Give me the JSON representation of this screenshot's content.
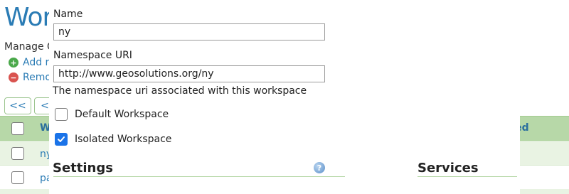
{
  "background": {
    "title": "Work",
    "manage_text": "Manage G",
    "add_label": "Add r",
    "remove_label": "Remo",
    "pager": {
      "first_label": "<<",
      "prev_label": "<"
    },
    "table": {
      "header_label": "W",
      "header_label_right": "ated",
      "rows": [
        {
          "name": "ny"
        },
        {
          "name": "pa"
        }
      ]
    }
  },
  "dialog": {
    "name_label": "Name",
    "name_value": "ny",
    "namespace_label": "Namespace URI",
    "namespace_value": "http://www.geosolutions.org/ny",
    "namespace_help": "The namespace uri associated with this workspace",
    "default_workspace_label": "Default Workspace",
    "default_workspace_checked": false,
    "isolated_workspace_label": "Isolated Workspace",
    "isolated_workspace_checked": true,
    "settings_title": "Settings",
    "services_title": "Services",
    "help_icon": "help-icon"
  },
  "colors": {
    "link": "#2b7cb5",
    "table_header": "#b7d8a8",
    "checkbox_checked": "#1a73e8"
  }
}
